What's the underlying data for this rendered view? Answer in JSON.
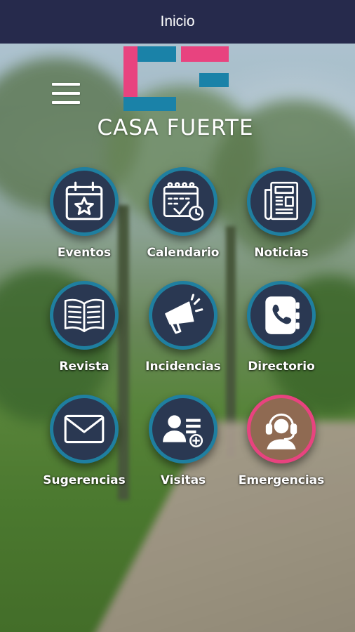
{
  "header": {
    "title": "Inicio"
  },
  "logo": {
    "brand_text": "CASA FUERTE"
  },
  "menu": {
    "icon": "hamburger-menu-icon"
  },
  "colors": {
    "header_bg": "#262a4c",
    "ring_blue": "#1f7fa0",
    "ring_pink": "#e8437f",
    "logo_pink": "#e8437f",
    "logo_blue": "#1a82a8"
  },
  "tiles": [
    {
      "label": "Eventos",
      "icon": "calendar-star-icon"
    },
    {
      "label": "Calendario",
      "icon": "calendar-check-icon"
    },
    {
      "label": "Noticias",
      "icon": "newspaper-icon"
    },
    {
      "label": "Revista",
      "icon": "open-book-icon"
    },
    {
      "label": "Incidencias",
      "icon": "megaphone-icon"
    },
    {
      "label": "Directorio",
      "icon": "phone-book-icon"
    },
    {
      "label": "Sugerencias",
      "icon": "envelope-icon"
    },
    {
      "label": "Visitas",
      "icon": "add-visitor-icon"
    },
    {
      "label": "Emergencias",
      "icon": "headset-operator-icon"
    }
  ]
}
